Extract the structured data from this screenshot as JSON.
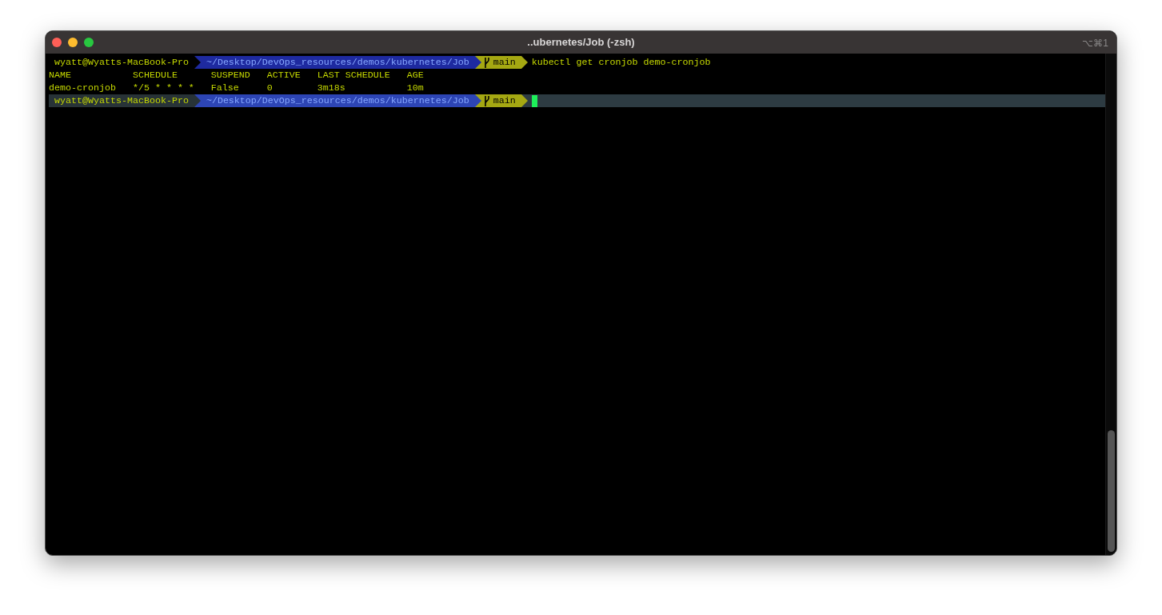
{
  "window": {
    "title": "..ubernetes/Job (-zsh)",
    "shortcut": "⌥⌘1"
  },
  "lines": [
    {
      "kind": "prompt",
      "current": false,
      "user": "wyatt@Wyatts-MacBook-Pro",
      "path": "~/Desktop/DevOps_resources/demos/kubernetes/Job",
      "branch": "main",
      "command": "kubectl get cronjob demo-cronjob"
    },
    {
      "kind": "table",
      "columns": [
        "NAME",
        "SCHEDULE",
        "SUSPEND",
        "ACTIVE",
        "LAST SCHEDULE",
        "AGE"
      ],
      "rows": [
        [
          "demo-cronjob",
          "*/5 * * * *",
          "False",
          "0",
          "3m18s",
          "10m"
        ]
      ]
    },
    {
      "kind": "prompt",
      "current": true,
      "user": "wyatt@Wyatts-MacBook-Pro",
      "path": "~/Desktop/DevOps_resources/demos/kubernetes/Job",
      "branch": "main"
    }
  ]
}
